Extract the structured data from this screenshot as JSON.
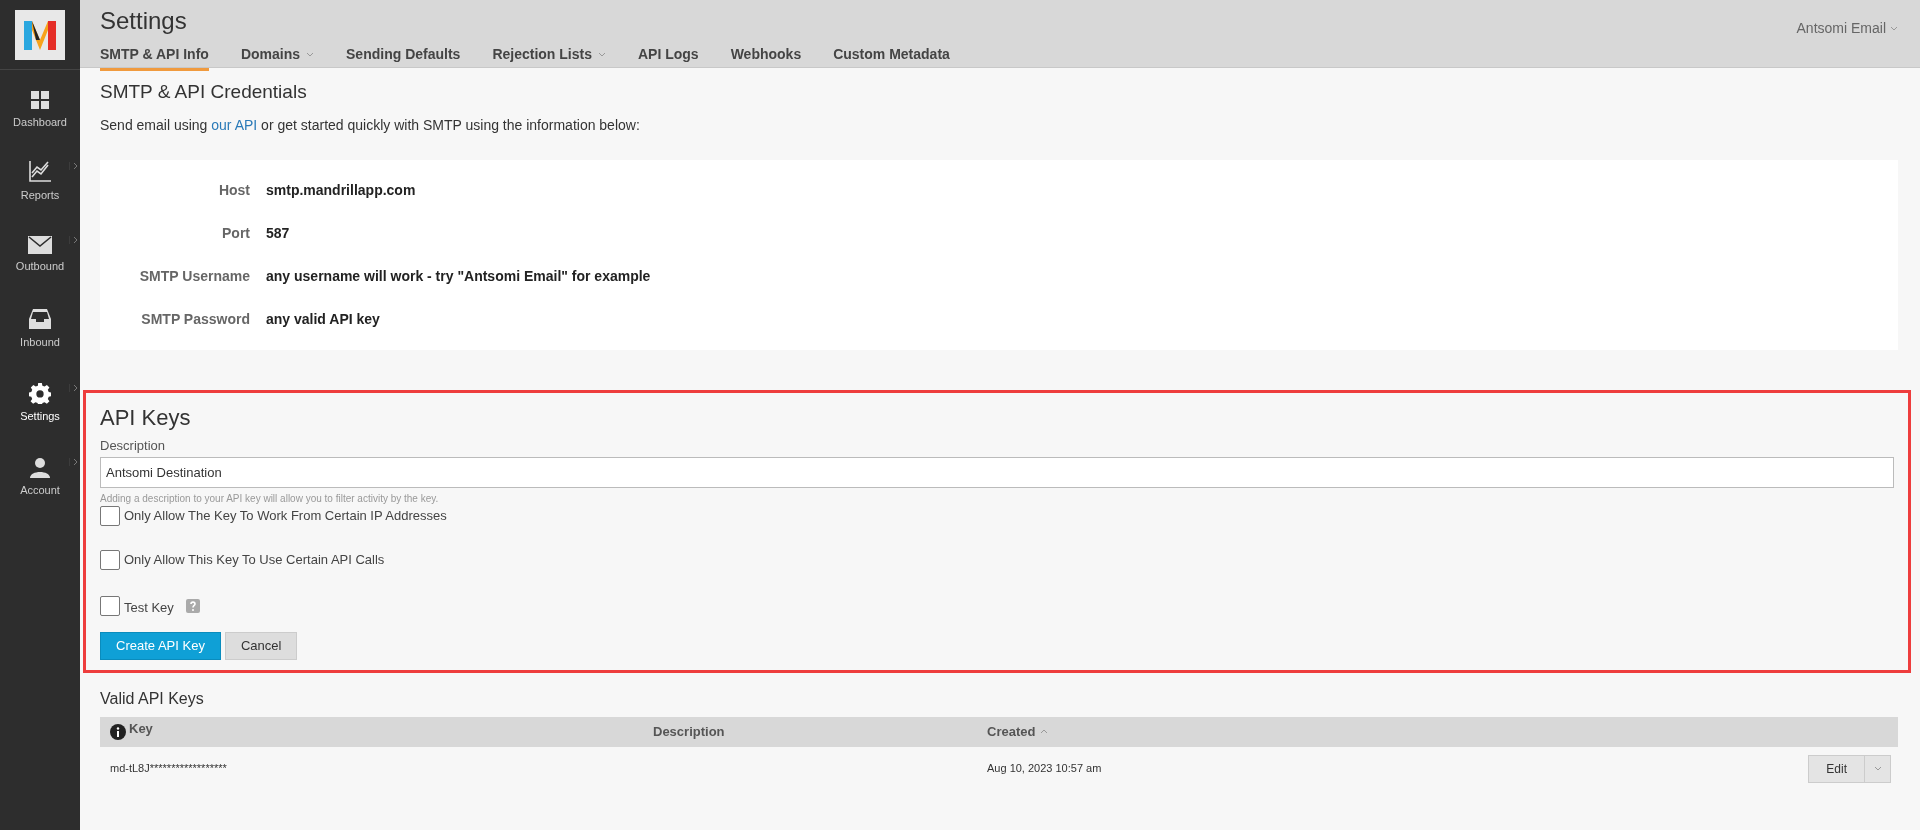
{
  "sidebar": {
    "items": [
      {
        "label": "Dashboard",
        "kind": "grid",
        "has_submenu": false,
        "selected": false
      },
      {
        "label": "Reports",
        "kind": "chart",
        "has_submenu": true,
        "selected": false
      },
      {
        "label": "Outbound",
        "kind": "envelope",
        "has_submenu": true,
        "selected": false
      },
      {
        "label": "Inbound",
        "kind": "inbox",
        "has_submenu": false,
        "selected": false
      },
      {
        "label": "Settings",
        "kind": "gear",
        "has_submenu": true,
        "selected": true
      },
      {
        "label": "Account",
        "kind": "person",
        "has_submenu": true,
        "selected": false
      }
    ]
  },
  "header": {
    "title": "Settings",
    "account": "Antsomi Email",
    "tabs": [
      {
        "label": "SMTP & API Info",
        "has_dropdown": false,
        "selected": true
      },
      {
        "label": "Domains",
        "has_dropdown": true,
        "selected": false
      },
      {
        "label": "Sending Defaults",
        "has_dropdown": false,
        "selected": false
      },
      {
        "label": "Rejection Lists",
        "has_dropdown": true,
        "selected": false
      },
      {
        "label": "API Logs",
        "has_dropdown": false,
        "selected": false
      },
      {
        "label": "Webhooks",
        "has_dropdown": false,
        "selected": false
      },
      {
        "label": "Custom Metadata",
        "has_dropdown": false,
        "selected": false
      }
    ]
  },
  "credentials": {
    "title": "SMTP & API Credentials",
    "intro": {
      "before": "Send email using ",
      "link": "our API",
      "after": " or get started quickly with SMTP using the information below:"
    },
    "rows": [
      {
        "label": "Host",
        "value": "smtp.mandrillapp.com"
      },
      {
        "label": "Port",
        "value": "587"
      },
      {
        "label": "SMTP Username",
        "value": "any username will work - try \"Antsomi Email\" for example"
      },
      {
        "label": "SMTP Password",
        "value": "any valid API key"
      }
    ]
  },
  "api_keys": {
    "title": "API Keys",
    "description_label": "Description",
    "description_value": "Antsomi Destination",
    "hint": "Adding a description to your API key will allow you to filter activity by the key.",
    "options": [
      {
        "label": "Only Allow The Key To Work From Certain IP Addresses",
        "checked": false,
        "has_help": false
      },
      {
        "label": "Only Allow This Key To Use Certain API Calls",
        "checked": false,
        "has_help": false
      },
      {
        "label": "Test Key",
        "checked": false,
        "has_help": true
      }
    ],
    "buttons": [
      {
        "label": "Create API Key",
        "kind": "primary"
      },
      {
        "label": "Cancel",
        "kind": "secondary"
      }
    ]
  },
  "valid_keys": {
    "title": "Valid API Keys",
    "columns": [
      {
        "label": "Key",
        "has_info": true,
        "sorted": false
      },
      {
        "label": "Description",
        "has_info": false,
        "sorted": false
      },
      {
        "label": "Created",
        "has_info": false,
        "sorted": true
      }
    ],
    "rows": [
      {
        "key": "md-tL8J******************",
        "created": "Aug 10, 2023 10:57 am",
        "action": "Edit"
      }
    ]
  }
}
